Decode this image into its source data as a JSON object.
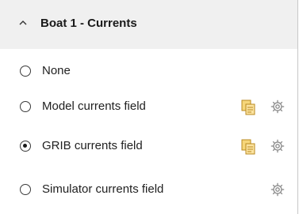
{
  "panel": {
    "title": "Boat 1 - Currents",
    "collapse_icon": "chevron-up-icon"
  },
  "options": [
    {
      "label": "None",
      "selected": false,
      "has_file_icon": false,
      "has_settings_icon": false
    },
    {
      "label": "Model currents field",
      "selected": false,
      "has_file_icon": true,
      "has_settings_icon": true
    },
    {
      "label": "GRIB currents field",
      "selected": true,
      "has_file_icon": true,
      "has_settings_icon": true
    },
    {
      "label": "Simulator currents field",
      "selected": false,
      "has_file_icon": false,
      "has_settings_icon": true
    }
  ],
  "colors": {
    "header_bg": "#f0f0f0",
    "file_icon": "#e8b84a",
    "gear_icon": "#8a8a8a"
  }
}
